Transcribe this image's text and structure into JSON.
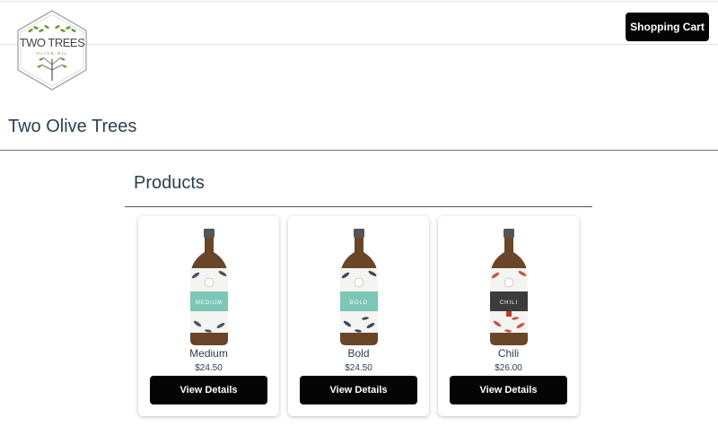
{
  "header": {
    "logo_text": "TWO TREES",
    "logo_subtext": "OLIVE OIL",
    "cart_label": "Shopping Cart"
  },
  "site": {
    "title": "Two Olive Trees"
  },
  "products": {
    "heading": "Products",
    "items": [
      {
        "name": "Medium",
        "price": "$24.50",
        "button_label": "View Details",
        "label_text": "MEDIUM",
        "label_color": "#7cc7b6",
        "accent_color": "#1f2a3a"
      },
      {
        "name": "Bold",
        "price": "$24.50",
        "button_label": "View Details",
        "label_text": "BOLD",
        "label_color": "#7cc7b6",
        "accent_color": "#1f2a3a"
      },
      {
        "name": "Chili",
        "price": "$26.00",
        "button_label": "View Details",
        "label_text": "CHILI",
        "label_color": "#3c3c3c",
        "accent_color": "#c0392b"
      }
    ]
  },
  "colors": {
    "button_bg": "#050505",
    "heading_text": "#2c3e50",
    "bottle_glass": "#6b4528",
    "bottle_cap": "#555555",
    "leaf_green": "#5e8a3a"
  }
}
